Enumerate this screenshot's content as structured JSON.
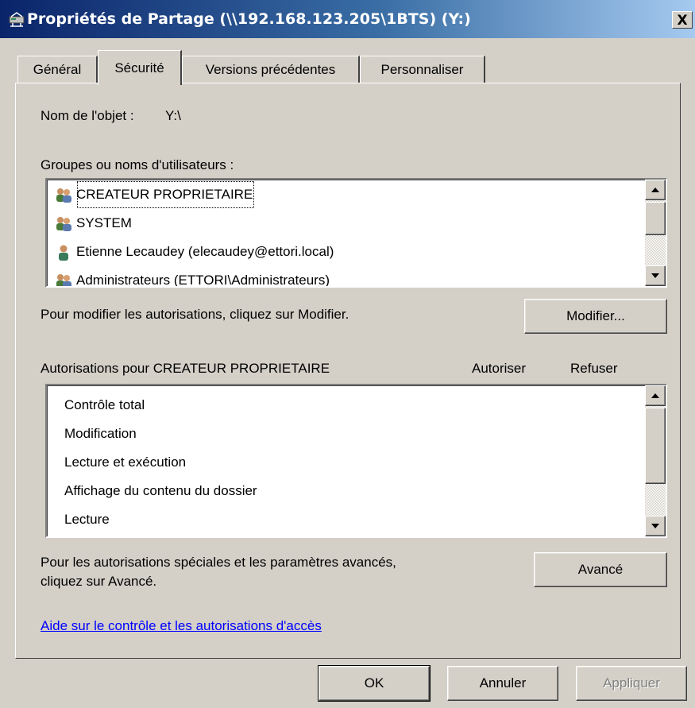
{
  "window": {
    "title": "Propriétés de Partage (\\\\192.168.123.205\\1BTS) (Y:)",
    "title_icon": "network-drive-icon",
    "close_label": "X"
  },
  "tabs": [
    {
      "label": "Général",
      "active": false
    },
    {
      "label": "Sécurité",
      "active": true
    },
    {
      "label": "Versions précédentes",
      "active": false
    },
    {
      "label": "Personnaliser",
      "active": false
    }
  ],
  "security": {
    "object_name_label": "Nom de l'objet :",
    "object_name_value": "Y:\\",
    "groups_label": "Groupes ou noms d'utilisateurs :",
    "users": [
      {
        "name": "CREATEUR PROPRIETAIRE",
        "icon": "group-icon",
        "selected": true
      },
      {
        "name": "SYSTEM",
        "icon": "group-icon",
        "selected": false
      },
      {
        "name": "Etienne Lecaudey (elecaudey@ettori.local)",
        "icon": "user-icon",
        "selected": false
      },
      {
        "name": "Administrateurs (ETTORI\\Administrateurs)",
        "icon": "group-icon",
        "selected": false
      }
    ],
    "modify_hint": "Pour modifier les autorisations, cliquez sur Modifier.",
    "modify_button": "Modifier...",
    "permissions_label": "Autorisations pour CREATEUR PROPRIETAIRE",
    "allow_header": "Autoriser",
    "deny_header": "Refuser",
    "permissions": [
      "Contrôle total",
      "Modification",
      "Lecture et exécution",
      "Affichage du contenu du dossier",
      "Lecture"
    ],
    "advanced_hint_line1": "Pour les autorisations spéciales et les paramètres avancés,",
    "advanced_hint_line2": "cliquez sur Avancé.",
    "advanced_button": "Avancé",
    "help_link": "Aide sur le contrôle et les autorisations d'accès"
  },
  "footer": {
    "ok": "OK",
    "cancel": "Annuler",
    "apply": "Appliquer",
    "apply_enabled": false
  },
  "colors": {
    "dialog_bg": "#d4d0c8",
    "titlebar_start": "#0a246a",
    "titlebar_end": "#a6caf0",
    "link": "#0000ff"
  }
}
